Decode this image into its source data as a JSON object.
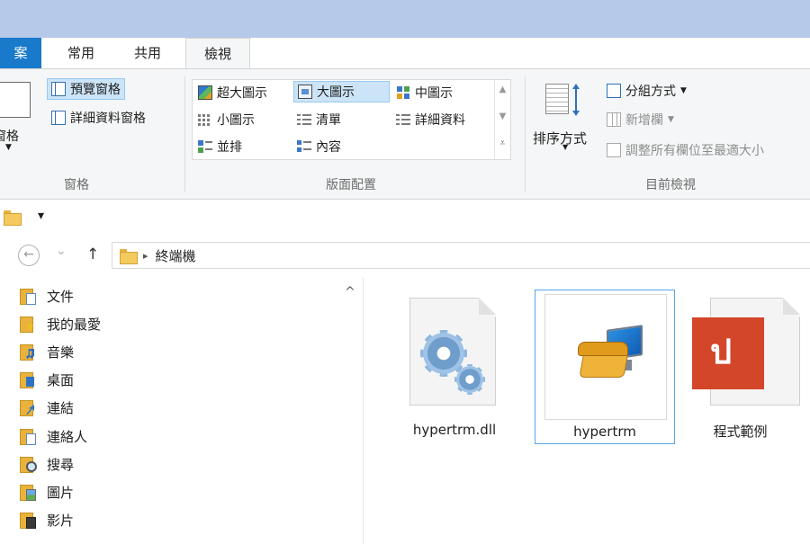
{
  "tabs": {
    "file": "案",
    "home": "常用",
    "share": "共用",
    "view": "檢視"
  },
  "ribbon": {
    "panes": {
      "nav_pane_partial": "窗格",
      "preview_pane": "預覽窗格",
      "details_pane": "詳細資料窗格",
      "group_label": "窗格"
    },
    "layout": {
      "items": [
        {
          "label": "超大圖示",
          "icon": "extra-large-icons-icon"
        },
        {
          "label": "大圖示",
          "icon": "large-icons-icon",
          "selected": true
        },
        {
          "label": "中圖示",
          "icon": "medium-icons-icon"
        },
        {
          "label": "小圖示",
          "icon": "small-icons-icon"
        },
        {
          "label": "清單",
          "icon": "list-icon"
        },
        {
          "label": "詳細資料",
          "icon": "details-icon"
        },
        {
          "label": "並排",
          "icon": "tiles-icon"
        },
        {
          "label": "內容",
          "icon": "content-icon"
        }
      ],
      "group_label": "版面配置"
    },
    "current_view": {
      "sort_by": "排序方式",
      "group_by": "分組方式",
      "add_columns": "新增欄",
      "size_all_columns": "調整所有欄位至最適大小",
      "group_label": "目前檢視"
    }
  },
  "qat": {
    "dropdown_glyph": "▾"
  },
  "address": {
    "back": "←",
    "forward_dropdown": "⌄",
    "up": "↑",
    "separator": "▸",
    "path": "終端機"
  },
  "nav_pane": {
    "scroll_up": "^",
    "items": [
      {
        "label": "文件",
        "icon": "documents-icon"
      },
      {
        "label": "我的最愛",
        "icon": "favorites-icon"
      },
      {
        "label": "音樂",
        "icon": "music-icon"
      },
      {
        "label": "桌面",
        "icon": "desktop-icon"
      },
      {
        "label": "連結",
        "icon": "links-icon"
      },
      {
        "label": "連絡人",
        "icon": "contacts-icon"
      },
      {
        "label": "搜尋",
        "icon": "searches-icon"
      },
      {
        "label": "圖片",
        "icon": "pictures-icon"
      },
      {
        "label": "影片",
        "icon": "videos-icon"
      }
    ]
  },
  "files": [
    {
      "name": "hypertrm.dll",
      "icon": "dll-gear-icon",
      "selected": false
    },
    {
      "name": "hypertrm",
      "icon": "hyperterminal-phone-icon",
      "selected": true
    },
    {
      "name": "程式範例",
      "icon": "pdf-document-icon",
      "selected": false
    }
  ],
  "colors": {
    "titlebar": "#b6c9e9",
    "file_tab": "#1979ca",
    "ribbon_bg": "#f5f6f7",
    "selection_bg": "#cce4f7",
    "selection_border": "#99c9ef",
    "tile_selection_border": "#55a5e8",
    "pdf_red": "#d4462a"
  }
}
